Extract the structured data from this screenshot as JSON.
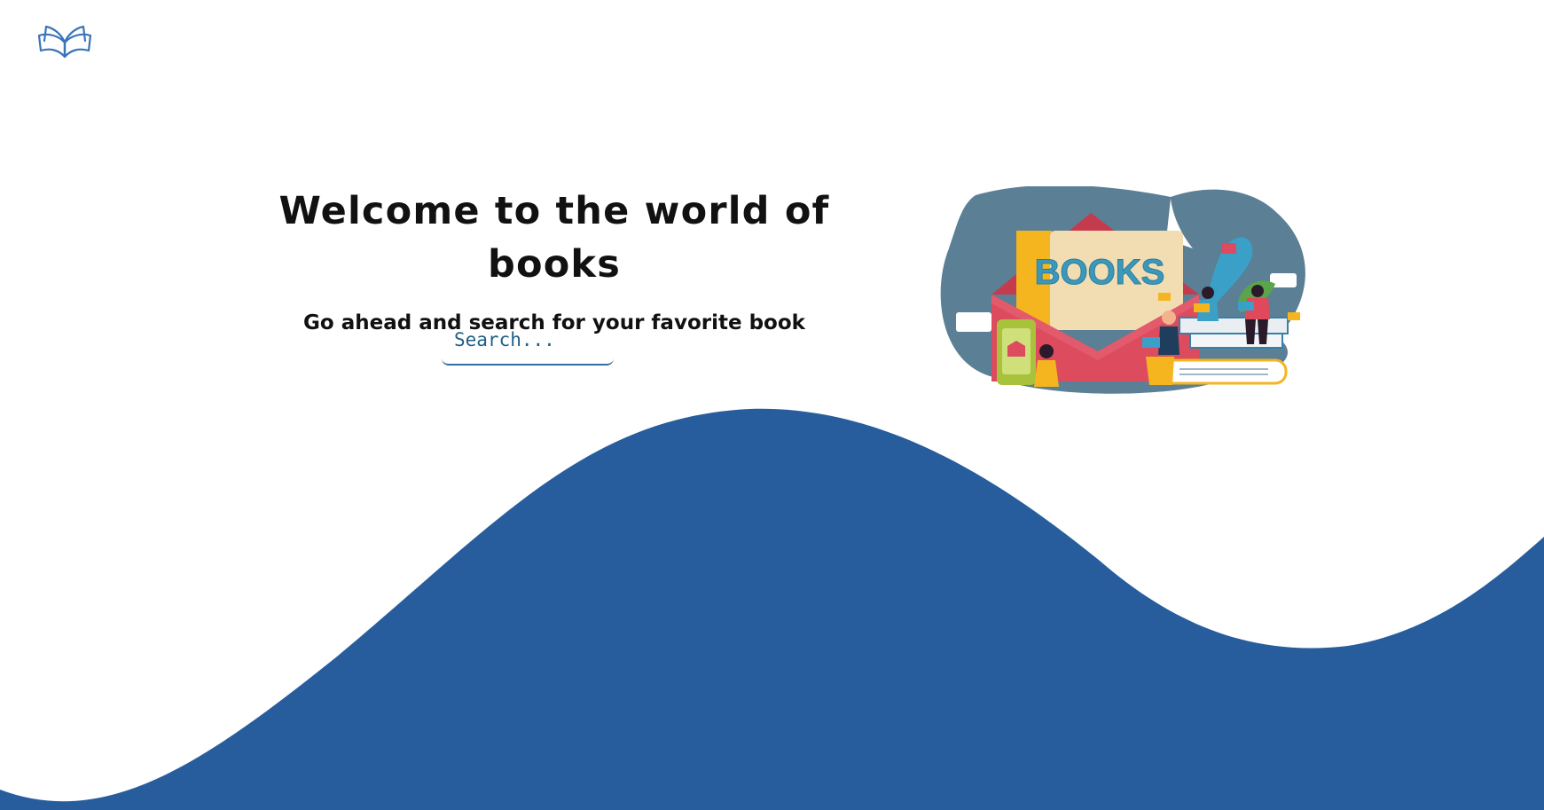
{
  "logo": {
    "icon": "open-book-icon"
  },
  "hero": {
    "title": "Welcome to the world of books",
    "subtitle": "Go ahead and search for your favorite book"
  },
  "search": {
    "placeholder": "Search...",
    "value": ""
  },
  "illustration": {
    "sign_text": "BOOKS"
  },
  "colors": {
    "wave": "#275d9d",
    "text": "#111111",
    "search_border": "#2f6fa5",
    "search_text": "#1f5f86",
    "blob": "#5b7f95",
    "envelope": "#dc4b5e",
    "sign_bg": "#f2dcb2",
    "sign_text": "#3b98ba",
    "accent_yellow": "#f4b51f"
  }
}
